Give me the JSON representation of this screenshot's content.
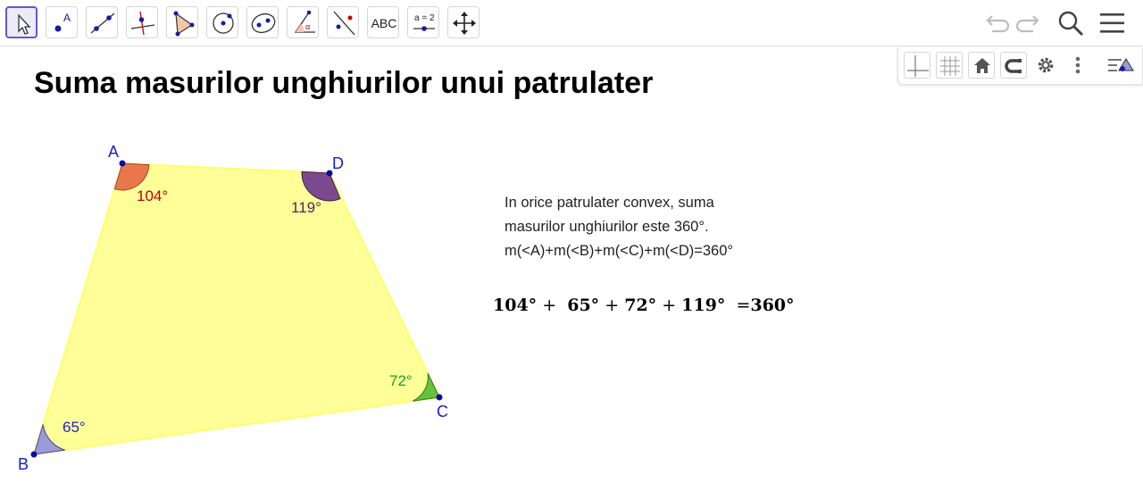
{
  "toolbar": {
    "tools": [
      {
        "id": "move",
        "icon": "arrow-cursor-icon"
      },
      {
        "id": "point",
        "icon": "point-icon",
        "label": "A"
      },
      {
        "id": "line",
        "icon": "line-icon"
      },
      {
        "id": "perpendicular",
        "icon": "perpendicular-line-icon"
      },
      {
        "id": "polygon",
        "icon": "polygon-icon"
      },
      {
        "id": "circle",
        "icon": "circle-icon"
      },
      {
        "id": "ellipse",
        "icon": "ellipse-icon"
      },
      {
        "id": "angle",
        "icon": "angle-icon",
        "label": "α"
      },
      {
        "id": "reflect",
        "icon": "reflect-icon"
      },
      {
        "id": "text",
        "icon": "text-icon",
        "label": "ABC"
      },
      {
        "id": "slider",
        "icon": "slider-icon",
        "label": "a = 2"
      },
      {
        "id": "move-graphics",
        "icon": "move-graphics-icon"
      }
    ],
    "active_tool": "move",
    "right_icons": [
      "undo-icon",
      "redo-icon",
      "search-icon",
      "menu-icon"
    ]
  },
  "stylebar": {
    "buttons": [
      "axes-icon",
      "grid-icon",
      "home-icon",
      "point-capture-icon",
      "settings-icon",
      "more-icon",
      "toggle-stylebar-icon"
    ]
  },
  "title": "Suma masurilor unghiurilor unui patrulater",
  "quadrilateral": {
    "fill_color": "#ffff99",
    "stroke_color": "#ffff66",
    "point_color": "#0b0b9e",
    "vertices": {
      "A": {
        "label": "A"
      },
      "B": {
        "label": "B"
      },
      "C": {
        "label": "C"
      },
      "D": {
        "label": "D"
      }
    },
    "angles": {
      "A": {
        "value": "104°",
        "color": "#e8784b",
        "label_color": "#c00000"
      },
      "B": {
        "value": "65°",
        "color": "#9b9bd8",
        "label_color": "#2222cc"
      },
      "C": {
        "value": "72°",
        "color": "#66c23d",
        "label_color": "#219e21"
      },
      "D": {
        "value": "119°",
        "color": "#7b4a8e",
        "label_color": "#4a2a66"
      }
    }
  },
  "description": {
    "line1": "In orice patrulater convex, suma",
    "line2": "masurilor unghiurilor este 360°.",
    "line3": "m(<A)+m(<B)+m(<C)+m(<D)=360°"
  },
  "formula": {
    "a": "104°",
    "b": "65°",
    "c": "72°",
    "d": "119°",
    "plus": "+",
    "equals": "=",
    "total": "360°"
  }
}
